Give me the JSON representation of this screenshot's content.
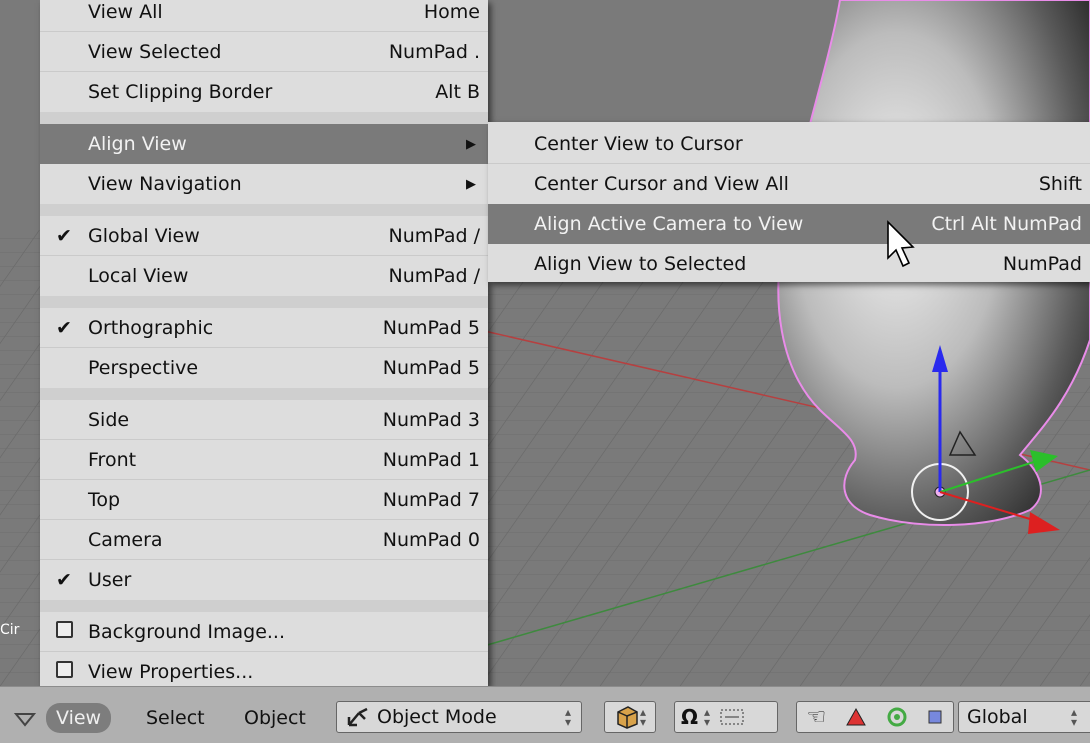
{
  "viewport": {
    "object_label": "Cir"
  },
  "view_menu": {
    "items": [
      {
        "label": "View All",
        "shortcut": "Home",
        "check": ""
      },
      {
        "label": "View Selected",
        "shortcut": "NumPad .",
        "check": ""
      },
      {
        "label": "Set Clipping Border",
        "shortcut": "Alt B",
        "check": ""
      },
      {
        "label": "Align View",
        "shortcut": "",
        "check": ""
      },
      {
        "label": "View Navigation",
        "shortcut": "",
        "check": ""
      },
      {
        "label": "Global View",
        "shortcut": "NumPad /",
        "check": "✔"
      },
      {
        "label": "Local View",
        "shortcut": "NumPad /",
        "check": ""
      },
      {
        "label": "Orthographic",
        "shortcut": "NumPad 5",
        "check": "✔"
      },
      {
        "label": "Perspective",
        "shortcut": "NumPad 5",
        "check": ""
      },
      {
        "label": "Side",
        "shortcut": "NumPad 3",
        "check": ""
      },
      {
        "label": "Front",
        "shortcut": "NumPad 1",
        "check": ""
      },
      {
        "label": "Top",
        "shortcut": "NumPad 7",
        "check": ""
      },
      {
        "label": "Camera",
        "shortcut": "NumPad 0",
        "check": ""
      },
      {
        "label": "User",
        "shortcut": "",
        "check": "✔"
      },
      {
        "label": "Background Image...",
        "shortcut": "",
        "check": ""
      },
      {
        "label": "View Properties...",
        "shortcut": "",
        "check": ""
      }
    ]
  },
  "align_submenu": {
    "items": [
      {
        "label": "Center View to Cursor",
        "shortcut": ""
      },
      {
        "label": "Center Cursor and View All",
        "shortcut": "Shift"
      },
      {
        "label": "Align Active Camera to View",
        "shortcut": "Ctrl Alt NumPad"
      },
      {
        "label": "Align View to Selected",
        "shortcut": "NumPad"
      }
    ]
  },
  "header": {
    "view": "View",
    "select": "Select",
    "object": "Object",
    "mode": "Object Mode",
    "orientation": "Global"
  },
  "colors": {
    "menu_bg": "#dddddd",
    "highlight": "#7a7a7a",
    "header_bg": "#b0b0b0",
    "viewport_bg": "#7a7a7a"
  }
}
